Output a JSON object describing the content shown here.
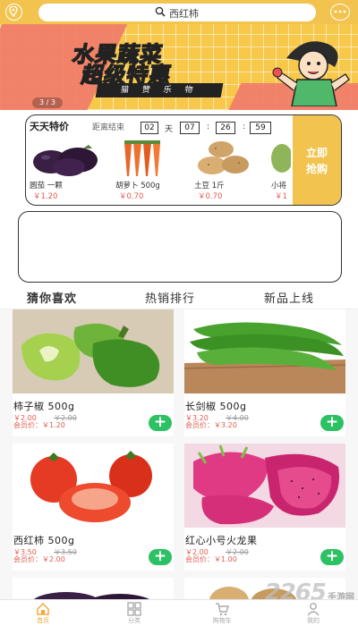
{
  "search": {
    "text": "西红柿"
  },
  "banner": {
    "title_line1": "水果蔬菜",
    "title_line2": "超级特惠",
    "subtitle": "猫 赞 乐 物",
    "pager": "3 / 3"
  },
  "deals": {
    "title": "天天特价",
    "countdown_label": "距离结束",
    "days": "02",
    "day_unit": "天",
    "hours": "07",
    "minutes": "26",
    "seconds": "59",
    "buy_line1": "立即",
    "buy_line2": "抢购",
    "items": [
      {
        "name": "圆茄 一颗",
        "price": "￥1.20"
      },
      {
        "name": "胡萝卜 500g",
        "price": "￥0.70"
      },
      {
        "name": "土豆 1斤",
        "price": "￥0.70"
      },
      {
        "name": "小将",
        "price": "￥1"
      }
    ]
  },
  "tabs": [
    "猜你喜欢",
    "热销排行",
    "新品上线"
  ],
  "products": [
    {
      "name": "柿子椒 500g",
      "price": "￥2.00",
      "old_price": "￥2.00",
      "member": "会员价：￥1.20"
    },
    {
      "name": "长剑椒 500g",
      "price": "￥3.20",
      "old_price": "￥4.00",
      "member": "会员价：￥3.20"
    },
    {
      "name": "西红柿 500g",
      "price": "￥3.50",
      "old_price": "￥3.50",
      "member": "会员价：￥2.00"
    },
    {
      "name": "红心小号火龙果",
      "price": "￥2.00",
      "old_price": "￥2.00",
      "member": "会员价：￥1.00"
    }
  ],
  "nav": [
    "首页",
    "分类",
    "购物车",
    "我的"
  ],
  "watermark": {
    "brand": "2265",
    "site": "手游网"
  },
  "colors": {
    "accent": "#f3c34f",
    "price": "#e25b4e",
    "add": "#2cc163"
  }
}
